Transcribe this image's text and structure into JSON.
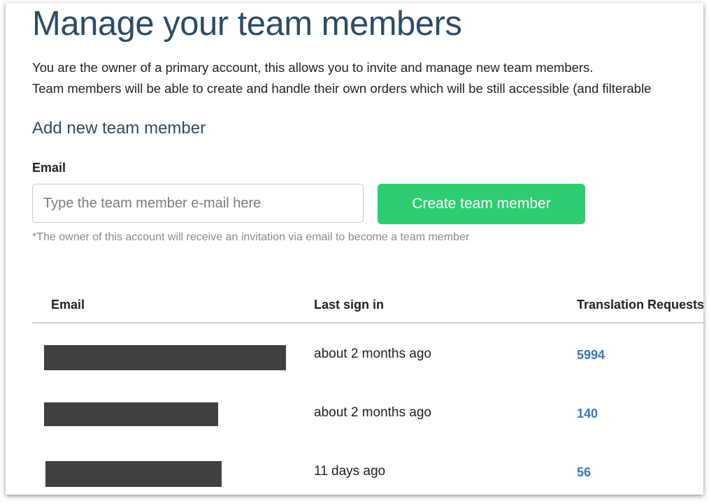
{
  "page": {
    "title": "Manage your team members",
    "description_line1": "You are the owner of a primary account, this allows you to invite and manage new team members.",
    "description_line2": "Team members will be able to create and handle their own orders which will be still accessible (and filterable"
  },
  "add_member": {
    "heading": "Add new team member",
    "email_label": "Email",
    "email_placeholder": "Type the team member e-mail here",
    "email_value": "",
    "create_button": "Create team member",
    "hint": "*The owner of this account will receive an invitation via email to become a team member"
  },
  "colors": {
    "accent_button": "#2ecc71",
    "title": "#2f4b64",
    "link": "#3a78b8"
  },
  "table": {
    "headers": [
      "Email",
      "Last sign in",
      "Translation Requests"
    ],
    "rows": [
      {
        "email": "[redacted]",
        "last_sign_in": "about 2 months ago",
        "translation_requests": "5994"
      },
      {
        "email": "[redacted]",
        "last_sign_in": "about 2 months ago",
        "translation_requests": "140"
      },
      {
        "email": "[redacted]",
        "last_sign_in": "11 days ago",
        "translation_requests": "56"
      }
    ]
  }
}
